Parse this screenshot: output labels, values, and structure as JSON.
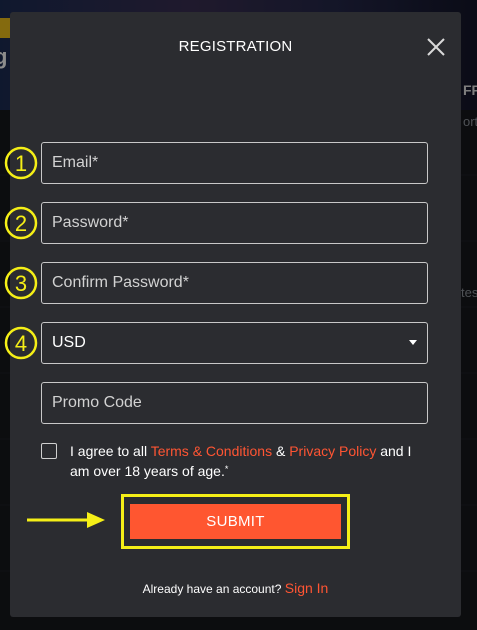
{
  "background": {
    "fragments": [
      "FF",
      "orts",
      "tes"
    ]
  },
  "modal": {
    "title": "REGISTRATION",
    "fields": {
      "email_placeholder": "Email*",
      "password_placeholder": "Password*",
      "confirm_placeholder": "Confirm Password*",
      "currency_value": "USD",
      "promo_placeholder": "Promo Code"
    },
    "steps": [
      "1",
      "2",
      "3",
      "4"
    ],
    "agree": {
      "prefix": "I agree to all ",
      "terms": "Terms & Conditions",
      "amp": " & ",
      "privacy": "Privacy Policy",
      "suffix": " and I am over 18 years of age.",
      "mark": "*"
    },
    "submit_label": "SUBMIT",
    "signin": {
      "prompt": "Already have an account? ",
      "link": "Sign In"
    }
  },
  "colors": {
    "accent": "#ff5630",
    "highlight": "#f5ef17",
    "modal_bg": "#2b2c30"
  },
  "icons": {
    "close": "close-icon",
    "dropdown": "caret-down-icon",
    "arrow": "arrow-right-icon"
  }
}
